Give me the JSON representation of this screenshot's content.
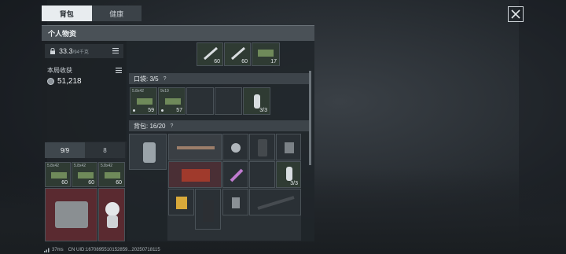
{
  "tabs": {
    "backpack": "背包",
    "health": "健康"
  },
  "panel_title": "个人物资",
  "weight": {
    "value": "33.3",
    "unit": "/94千克"
  },
  "income": {
    "label": "本局收获",
    "value": "51,218"
  },
  "top_items": [
    {
      "label": "",
      "count": "60"
    },
    {
      "label": "",
      "count": "60"
    },
    {
      "label": "",
      "count": "17"
    }
  ],
  "pocket": {
    "header": "口袋: 3/5",
    "help": "?",
    "items": [
      {
        "label": "5.8x42",
        "count": "59"
      },
      {
        "label": "9x19",
        "count": "57"
      },
      {
        "label": "",
        "count": ""
      },
      {
        "label": "",
        "count": ""
      },
      {
        "label": "",
        "count": "3/3"
      }
    ]
  },
  "bag": {
    "header": "背包: 16/20",
    "help": "?",
    "items": [
      {
        "label": ""
      },
      {
        "label": ""
      },
      {
        "label": ""
      },
      {
        "label": ""
      },
      {
        "label": ""
      },
      {
        "label": ""
      },
      {
        "label": ""
      },
      {
        "label": "",
        "count": "3/3"
      },
      {
        "label": ""
      },
      {
        "label": ""
      },
      {
        "label": ""
      },
      {
        "label": ""
      }
    ]
  },
  "strip": {
    "tab1": "9/9",
    "tab2": "8"
  },
  "left_items": [
    {
      "label": "5.8x42",
      "count": "60"
    },
    {
      "label": "5.8x42",
      "count": "60"
    },
    {
      "label": "5.8x42",
      "count": "60"
    },
    {
      "label": "",
      "count": ""
    },
    {
      "label": "",
      "count": ""
    }
  ],
  "footer": {
    "ping": "37ms",
    "uid": "CN UID:1670895510152859...20250718115"
  },
  "colors": {
    "accent_red": "#5a2a30",
    "accent_green": "#2f3b33",
    "panel": "#2b3136"
  }
}
